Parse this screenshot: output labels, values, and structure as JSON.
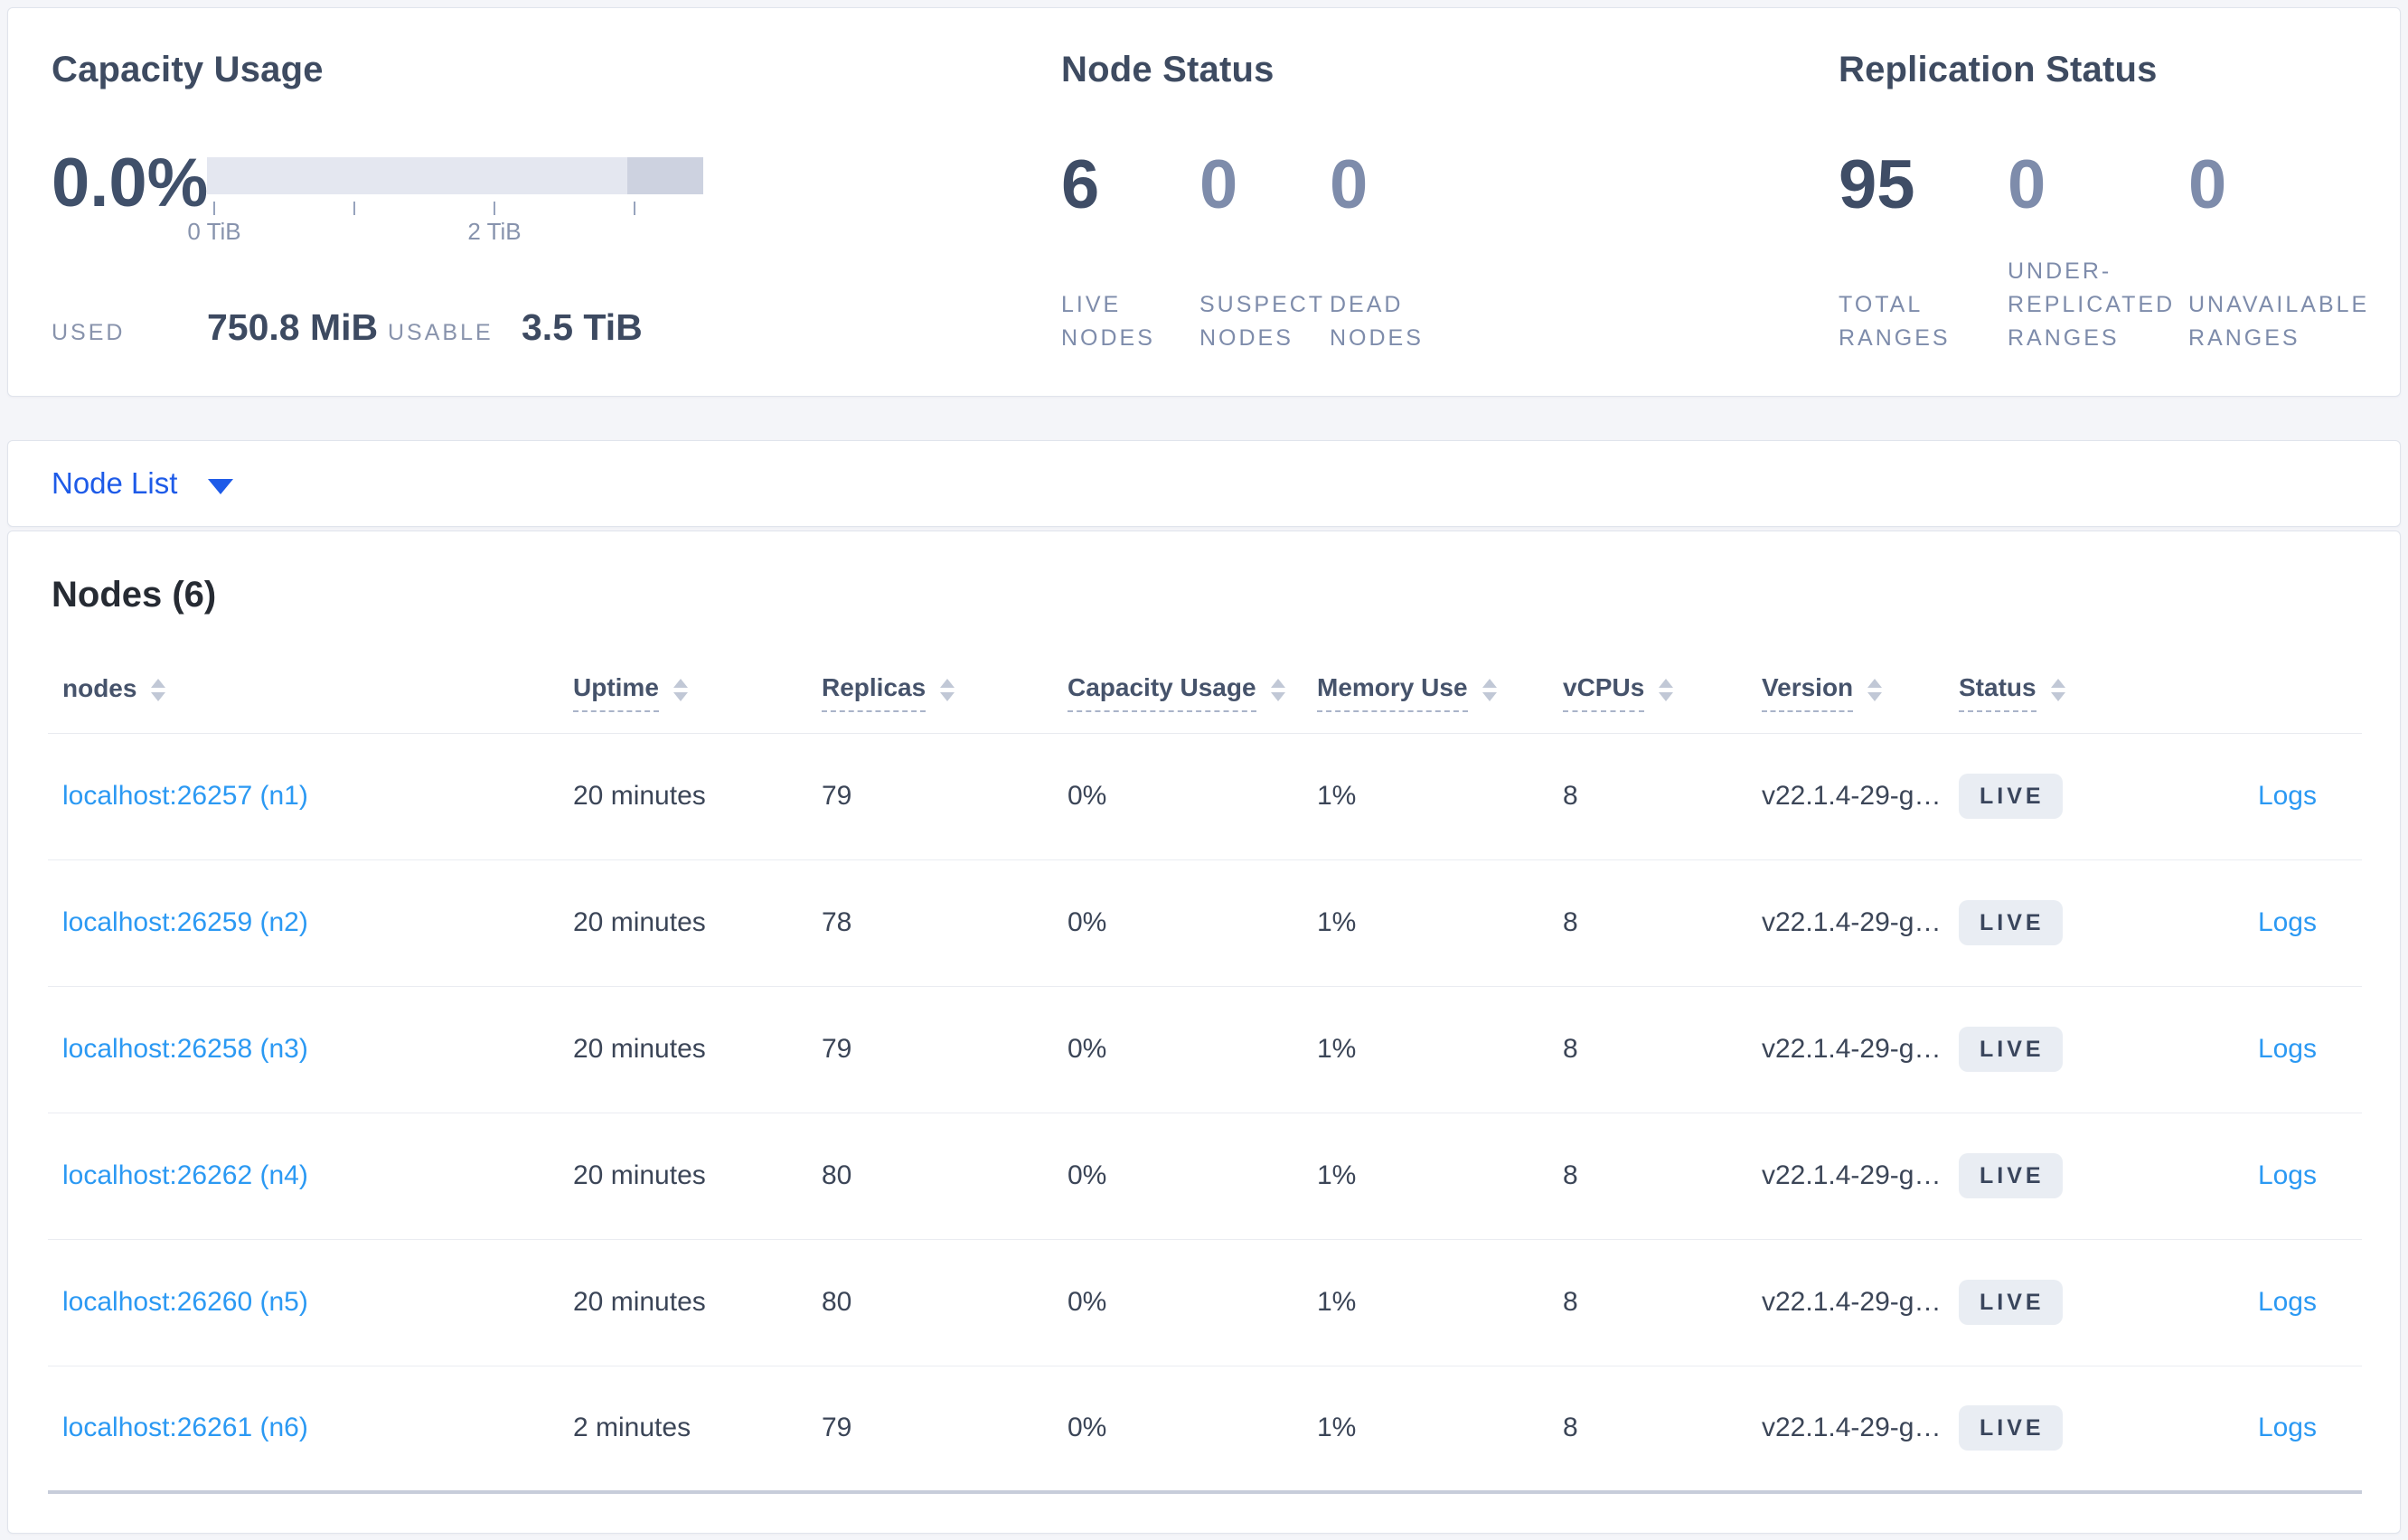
{
  "summary_cards": {
    "capacity": {
      "title": "Capacity Usage",
      "percent": "0.0%",
      "tick_labels": [
        "0 TiB",
        "2 TiB"
      ],
      "used_label": "USED",
      "used_value": "750.8 MiB",
      "usable_label": "USABLE",
      "usable_value": "3.5 TiB"
    },
    "node_status": {
      "title": "Node Status",
      "stats": [
        {
          "value": "6",
          "label": "LIVE NODES"
        },
        {
          "value": "0",
          "label": "SUSPECT NODES"
        },
        {
          "value": "0",
          "label": "DEAD NODES"
        }
      ]
    },
    "replication_status": {
      "title": "Replication Status",
      "stats": [
        {
          "value": "95",
          "label": "TOTAL RANGES"
        },
        {
          "value": "0",
          "label": "UNDER-REPLICATED RANGES"
        },
        {
          "value": "0",
          "label": "UNAVAILABLE RANGES"
        }
      ]
    }
  },
  "node_list_dropdown": {
    "label": "Node List"
  },
  "nodes_table": {
    "heading": "Nodes (6)",
    "columns": [
      {
        "label": "nodes"
      },
      {
        "label": "Uptime"
      },
      {
        "label": "Replicas"
      },
      {
        "label": "Capacity Usage"
      },
      {
        "label": "Memory Use"
      },
      {
        "label": "vCPUs"
      },
      {
        "label": "Version"
      },
      {
        "label": "Status"
      }
    ],
    "rows": [
      {
        "node": "localhost:26257 (n1)",
        "uptime": "20 minutes",
        "replicas": "79",
        "capacity_usage": "0%",
        "memory_use": "1%",
        "vcpus": "8",
        "version": "v22.1.4-29-g…",
        "status": "LIVE",
        "logs": "Logs"
      },
      {
        "node": "localhost:26259 (n2)",
        "uptime": "20 minutes",
        "replicas": "78",
        "capacity_usage": "0%",
        "memory_use": "1%",
        "vcpus": "8",
        "version": "v22.1.4-29-g…",
        "status": "LIVE",
        "logs": "Logs"
      },
      {
        "node": "localhost:26258 (n3)",
        "uptime": "20 minutes",
        "replicas": "79",
        "capacity_usage": "0%",
        "memory_use": "1%",
        "vcpus": "8",
        "version": "v22.1.4-29-g…",
        "status": "LIVE",
        "logs": "Logs"
      },
      {
        "node": "localhost:26262 (n4)",
        "uptime": "20 minutes",
        "replicas": "80",
        "capacity_usage": "0%",
        "memory_use": "1%",
        "vcpus": "8",
        "version": "v22.1.4-29-g…",
        "status": "LIVE",
        "logs": "Logs"
      },
      {
        "node": "localhost:26260 (n5)",
        "uptime": "20 minutes",
        "replicas": "80",
        "capacity_usage": "0%",
        "memory_use": "1%",
        "vcpus": "8",
        "version": "v22.1.4-29-g…",
        "status": "LIVE",
        "logs": "Logs"
      },
      {
        "node": "localhost:26261 (n6)",
        "uptime": "2 minutes",
        "replicas": "79",
        "capacity_usage": "0%",
        "memory_use": "1%",
        "vcpus": "8",
        "version": "v22.1.4-29-g…",
        "status": "LIVE",
        "logs": "Logs"
      }
    ]
  },
  "colors": {
    "link_blue": "#2b99f3",
    "dropdown_blue": "#1e5be8",
    "badge_bg": "#e9edf3",
    "bar_light": "#e4e7f0",
    "bar_dark": "#cdd2e0"
  }
}
